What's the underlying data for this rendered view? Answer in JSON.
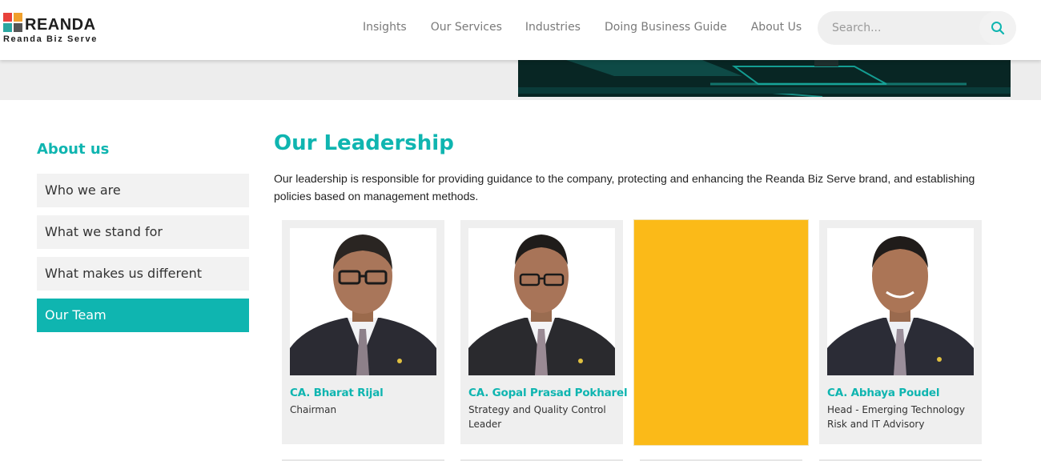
{
  "header": {
    "logo": {
      "word": "REANDA",
      "sub": "Reanda Biz Serve"
    },
    "nav": [
      "Insights",
      "Our Services",
      "Industries",
      "Doing Business Guide",
      "About Us"
    ],
    "search": {
      "placeholder": "Search...",
      "icon": "search-icon"
    }
  },
  "sidebar": {
    "title": "About us",
    "items": [
      {
        "label": "Who we are",
        "active": false
      },
      {
        "label": "What we stand for",
        "active": false
      },
      {
        "label": "What makes us different",
        "active": false
      },
      {
        "label": "Our Team",
        "active": true
      }
    ]
  },
  "main": {
    "title": "Our Leadership",
    "intro": "Our leadership is responsible for providing guidance to the company, protecting and enhancing the Reanda Biz Serve brand, and establishing policies based on management methods.",
    "cards": [
      {
        "name": "CA. Bharat Rijal",
        "role": "Chairman"
      },
      {
        "name": "CA. Gopal Prasad Pokharel",
        "role": "Strategy and Quality Control Leader"
      },
      {
        "name": "",
        "role": ""
      },
      {
        "name": "CA. Abhaya Poudel",
        "role": "Head - Emerging Technology Risk and IT Advisory"
      }
    ]
  },
  "colors": {
    "accent": "#0fb5b0",
    "placeholder_card": "#fbba18",
    "card_bg": "#efefef"
  }
}
